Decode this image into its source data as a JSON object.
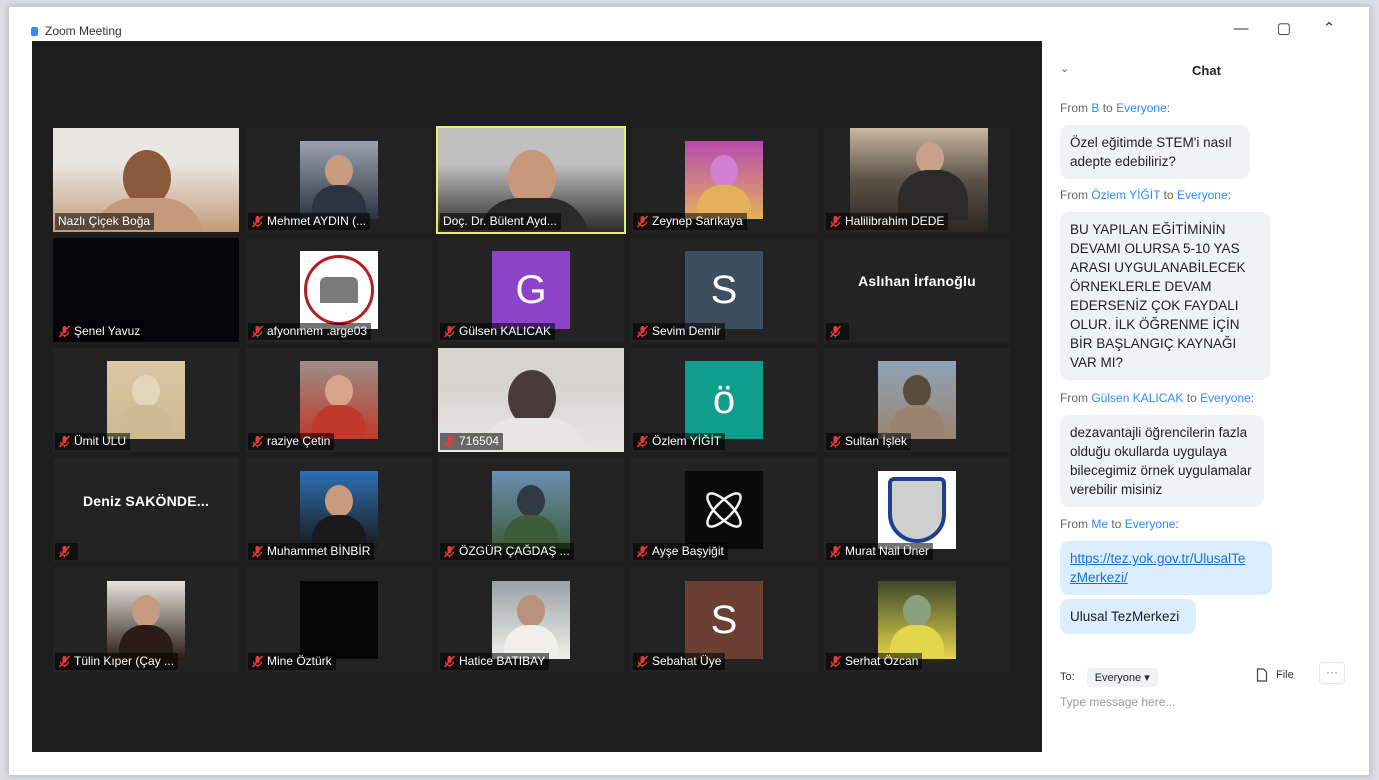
{
  "window": {
    "title": "Zoom Meeting",
    "controls": [
      "—",
      "▢",
      "⌃"
    ]
  },
  "participants": [
    {
      "name": "Nazlı Çiçek Boğa",
      "muted": false,
      "tile": "photo",
      "colors": [
        "#e9e6e2",
        "#c49a7a",
        "#8b5a3c"
      ]
    },
    {
      "name": "Mehmet AYDIN (...",
      "muted": true,
      "tile": "photo-small",
      "colors": [
        "#9aa3ad",
        "#2b3440",
        "#c69b7f"
      ]
    },
    {
      "name": "Doç. Dr. Bülent Ayd...",
      "muted": false,
      "tile": "photo",
      "active": true,
      "colors": [
        "#bfbfbf",
        "#2a2a2a",
        "#c8987a"
      ]
    },
    {
      "name": "Zeynep Sarıkaya",
      "muted": true,
      "tile": "photo-small",
      "colors": [
        "#b74bb0",
        "#e5b05c",
        "#d27ed2"
      ]
    },
    {
      "name": "Halilibrahim DEDE",
      "muted": true,
      "tile": "photo-wide",
      "colors": [
        "#5b5147",
        "#2c2724",
        "#c9b8a2"
      ]
    },
    {
      "name": "Şenel Yavuz",
      "muted": true,
      "tile": "black",
      "colors": [
        "#05050a"
      ]
    },
    {
      "name": "afyonmem .arge03",
      "muted": true,
      "tile": "logo",
      "colors": [
        "#ffffff",
        "#b02020",
        "#7a7a7a"
      ]
    },
    {
      "name": "Gülsen KALICAK",
      "muted": true,
      "tile": "letter",
      "letter": "G",
      "colors": [
        "#8e44c9"
      ]
    },
    {
      "name": "Sevim Demir",
      "muted": true,
      "tile": "letter",
      "letter": "S",
      "colors": [
        "#3d4f5e"
      ]
    },
    {
      "name": "",
      "muted": true,
      "tile": "bigname",
      "bigname": "Aslıhan İrfanoğlu",
      "colors": []
    },
    {
      "name": "Ümit ULU",
      "muted": true,
      "tile": "photo-small",
      "colors": [
        "#d9c8a5",
        "#cdb992",
        "#e3d6b9"
      ]
    },
    {
      "name": "raziye Çetin",
      "muted": true,
      "tile": "photo-small",
      "colors": [
        "#9b8f86",
        "#c0392b",
        "#d9a58a"
      ]
    },
    {
      "name": "716504",
      "muted": true,
      "tile": "photo",
      "colors": [
        "#d7d4d0",
        "#e8e6e3",
        "#4a3b3b"
      ]
    },
    {
      "name": "Özlem YİĞİT",
      "muted": true,
      "tile": "letter",
      "letter": "ö",
      "colors": [
        "#0f9e8c"
      ]
    },
    {
      "name": "Sultan İşlek",
      "muted": true,
      "tile": "photo-small",
      "colors": [
        "#8fa3b8",
        "#9a8470",
        "#5a4b3d"
      ]
    },
    {
      "name": "",
      "muted": true,
      "tile": "bigname",
      "bigname": "Deniz SAKÖNDE...",
      "colors": []
    },
    {
      "name": "Muhammet BİNBİR",
      "muted": true,
      "tile": "photo-small",
      "colors": [
        "#2d6fb5",
        "#1a1a1a",
        "#c99a7d"
      ]
    },
    {
      "name": "ÖZGÜR ÇAĞDAŞ ...",
      "muted": true,
      "tile": "photo-small",
      "colors": [
        "#6b8fb3",
        "#3e5c3a",
        "#2f3a44"
      ]
    },
    {
      "name": "Ayşe Başyiğit",
      "muted": true,
      "tile": "icon",
      "colors": [
        "#0a0a0a",
        "#f2f2f2"
      ]
    },
    {
      "name": "Murat Nail Üner",
      "muted": true,
      "tile": "logo2",
      "colors": [
        "#ffffff",
        "#1f3f8f",
        "#cfcfcf"
      ]
    },
    {
      "name": "Tülin Kıper (Çay ...",
      "muted": true,
      "tile": "photo-small",
      "colors": [
        "#e6e3dd",
        "#2b1d16",
        "#c79a82"
      ]
    },
    {
      "name": "Mine Öztürk",
      "muted": true,
      "tile": "black-small",
      "colors": [
        "#050505"
      ]
    },
    {
      "name": "Hatice BATIBAY",
      "muted": true,
      "tile": "photo-small",
      "colors": [
        "#9aa2a7",
        "#f0efea",
        "#b9927d"
      ]
    },
    {
      "name": "Sebahat Üye",
      "muted": true,
      "tile": "letter",
      "letter": "S",
      "colors": [
        "#6a3f34"
      ]
    },
    {
      "name": "Serhat Özcan",
      "muted": true,
      "tile": "photo-small",
      "colors": [
        "#3d4a2b",
        "#e3d54a",
        "#8aa07c"
      ]
    }
  ],
  "chat": {
    "title": "Chat",
    "messages": [
      {
        "from": "B",
        "to": "Everyone",
        "text": "Özel eğitimde STEM'i nasıl adepte edebiliriz?",
        "mine": false
      },
      {
        "from": "Özlem YİĞİT",
        "to": "Everyone",
        "text": "BU YAPILAN  EĞİTİMİNİN DEVAMI OLURSA  5-10 YAS ARASI UYGULANABİLECEK ÖRNEKLERLE DEVAM EDERSENİZ ÇOK FAYDALI OLUR. İLK ÖĞRENME İÇİN BİR BAŞLANGIÇ KAYNAĞI VAR MI?",
        "mine": false
      },
      {
        "from": "Gülsen KALICAK",
        "to": "Everyone",
        "text": "dezavantajli öğrencilerin fazla olduğu okullarda uygulaya bilecegimiz örnek uygulamalar verebilir misiniz",
        "mine": false
      },
      {
        "from": "Me",
        "to": "Everyone",
        "link": "https://tez.yok.gov.tr/UlusalTezMerkezi/",
        "link_line1": "https://tez.yok.gov.tr/UlusalTe",
        "link_line2": "zMerkezi/",
        "mine": true
      },
      {
        "text": "Ulusal TezMerkezi",
        "mine": true
      }
    ],
    "labels": {
      "from": "From",
      "to": "to"
    },
    "to_label": "To:",
    "recipient": "Everyone",
    "file_label": "File",
    "more_label": "···",
    "input_placeholder": "Type message here..."
  }
}
